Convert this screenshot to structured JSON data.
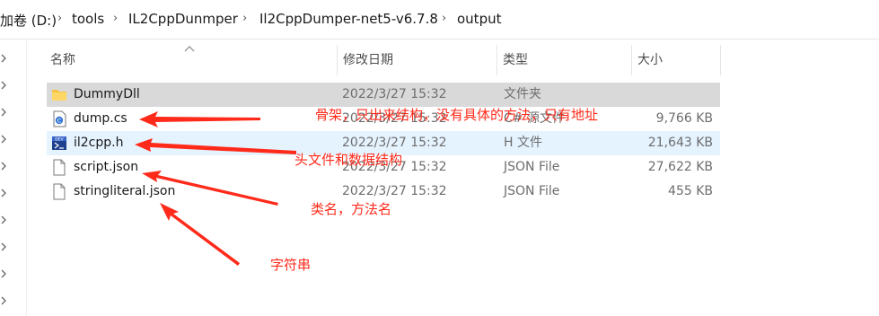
{
  "breadcrumb": {
    "items": [
      "加卷 (D:)",
      "tools",
      "IL2CppDunmper",
      "Il2CppDumper-net5-v6.7.8",
      "output"
    ]
  },
  "columns": {
    "name": "名称",
    "modified": "修改日期",
    "type": "类型",
    "size": "大小"
  },
  "files": [
    {
      "name": "DummyDll",
      "modified": "2022/3/27 15:32",
      "type": "文件夹",
      "size": "",
      "icon": "folder-icon"
    },
    {
      "name": "dump.cs",
      "modified": "2022/3/27 15:32",
      "type": "C# 源文件",
      "size": "9,766 KB",
      "icon": "csharp-file-icon"
    },
    {
      "name": "il2cpp.h",
      "modified": "2022/3/27 15:32",
      "type": "H 文件",
      "size": "21,643 KB",
      "icon": "dev-header-file-icon"
    },
    {
      "name": "script.json",
      "modified": "2022/3/27 15:32",
      "type": "JSON File",
      "size": "27,622 KB",
      "icon": "generic-file-icon"
    },
    {
      "name": "stringliteral.json",
      "modified": "2022/3/27 15:32",
      "type": "JSON File",
      "size": "455 KB",
      "icon": "generic-file-icon"
    }
  ],
  "annotations": {
    "dump": "骨架，只出来结构，没有具体的方法，只有地址",
    "header": "头文件和数据结构",
    "script": "类名，方法名",
    "strings": "字符串"
  },
  "colors": {
    "annotation": "#ff2a1a",
    "selected_row": "#d9d9d9",
    "hover_row": "#e5f3ff",
    "folder": "#f6c344"
  }
}
